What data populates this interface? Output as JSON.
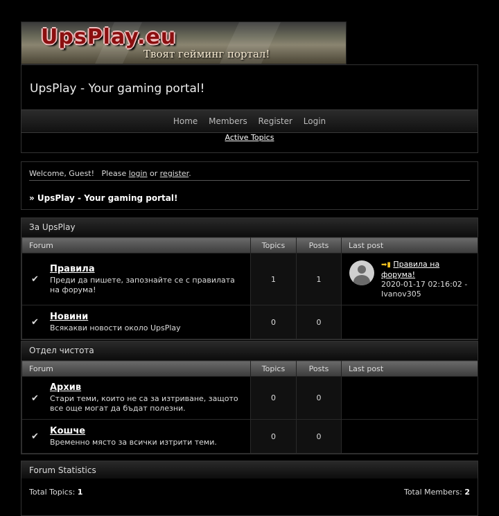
{
  "banner": {
    "logo_text": "UpsPlay.eu",
    "tagline": "Твоят гейминг портал!"
  },
  "header": {
    "title": "UpsPlay - Your gaming portal!"
  },
  "nav": {
    "items": [
      "Home",
      "Members",
      "Register",
      "Login"
    ],
    "active_topics": "Active Topics"
  },
  "welcome": {
    "prefix": "Welcome, Guest!   Please",
    "login": "login",
    "or": "or",
    "register": "register",
    "suffix": ".",
    "breadcrumb": "» UpsPlay - Your gaming portal!"
  },
  "columns": {
    "forum": "Forum",
    "topics": "Topics",
    "posts": "Posts",
    "last_post": "Last post"
  },
  "categories": [
    {
      "name": "За UpsPlay",
      "forums": [
        {
          "name": "Правила",
          "description": "Преди да пишете, запознайте се с правилата на форума!",
          "topics": "1",
          "posts": "1",
          "last_post": {
            "title": "Правила на форума!",
            "datetime": "2020-01-17 02:16:02 -",
            "author": "Ivanov305"
          }
        },
        {
          "name": "Новини",
          "description": "Всякакви новости около UpsPlay",
          "topics": "0",
          "posts": "0"
        }
      ]
    },
    {
      "name": "Отдел чистота",
      "forums": [
        {
          "name": "Архив",
          "description": "Стари теми, които не са за изтриване, защото все още могат да бъдат полезни.",
          "topics": "0",
          "posts": "0"
        },
        {
          "name": "Кошче",
          "description": "Временно място за всички изтрити теми.",
          "topics": "0",
          "posts": "0"
        }
      ]
    }
  ],
  "stats": {
    "title": "Forum Statistics",
    "total_topics_label": "Total Topics:",
    "total_topics": "1",
    "total_members_label": "Total Members:",
    "total_members": "2"
  },
  "colors": {
    "background": "#000000",
    "nav_gradient_top": "#2b2b2b",
    "header_row": "#6a6a6a",
    "logo_red": "#8b0f10"
  }
}
